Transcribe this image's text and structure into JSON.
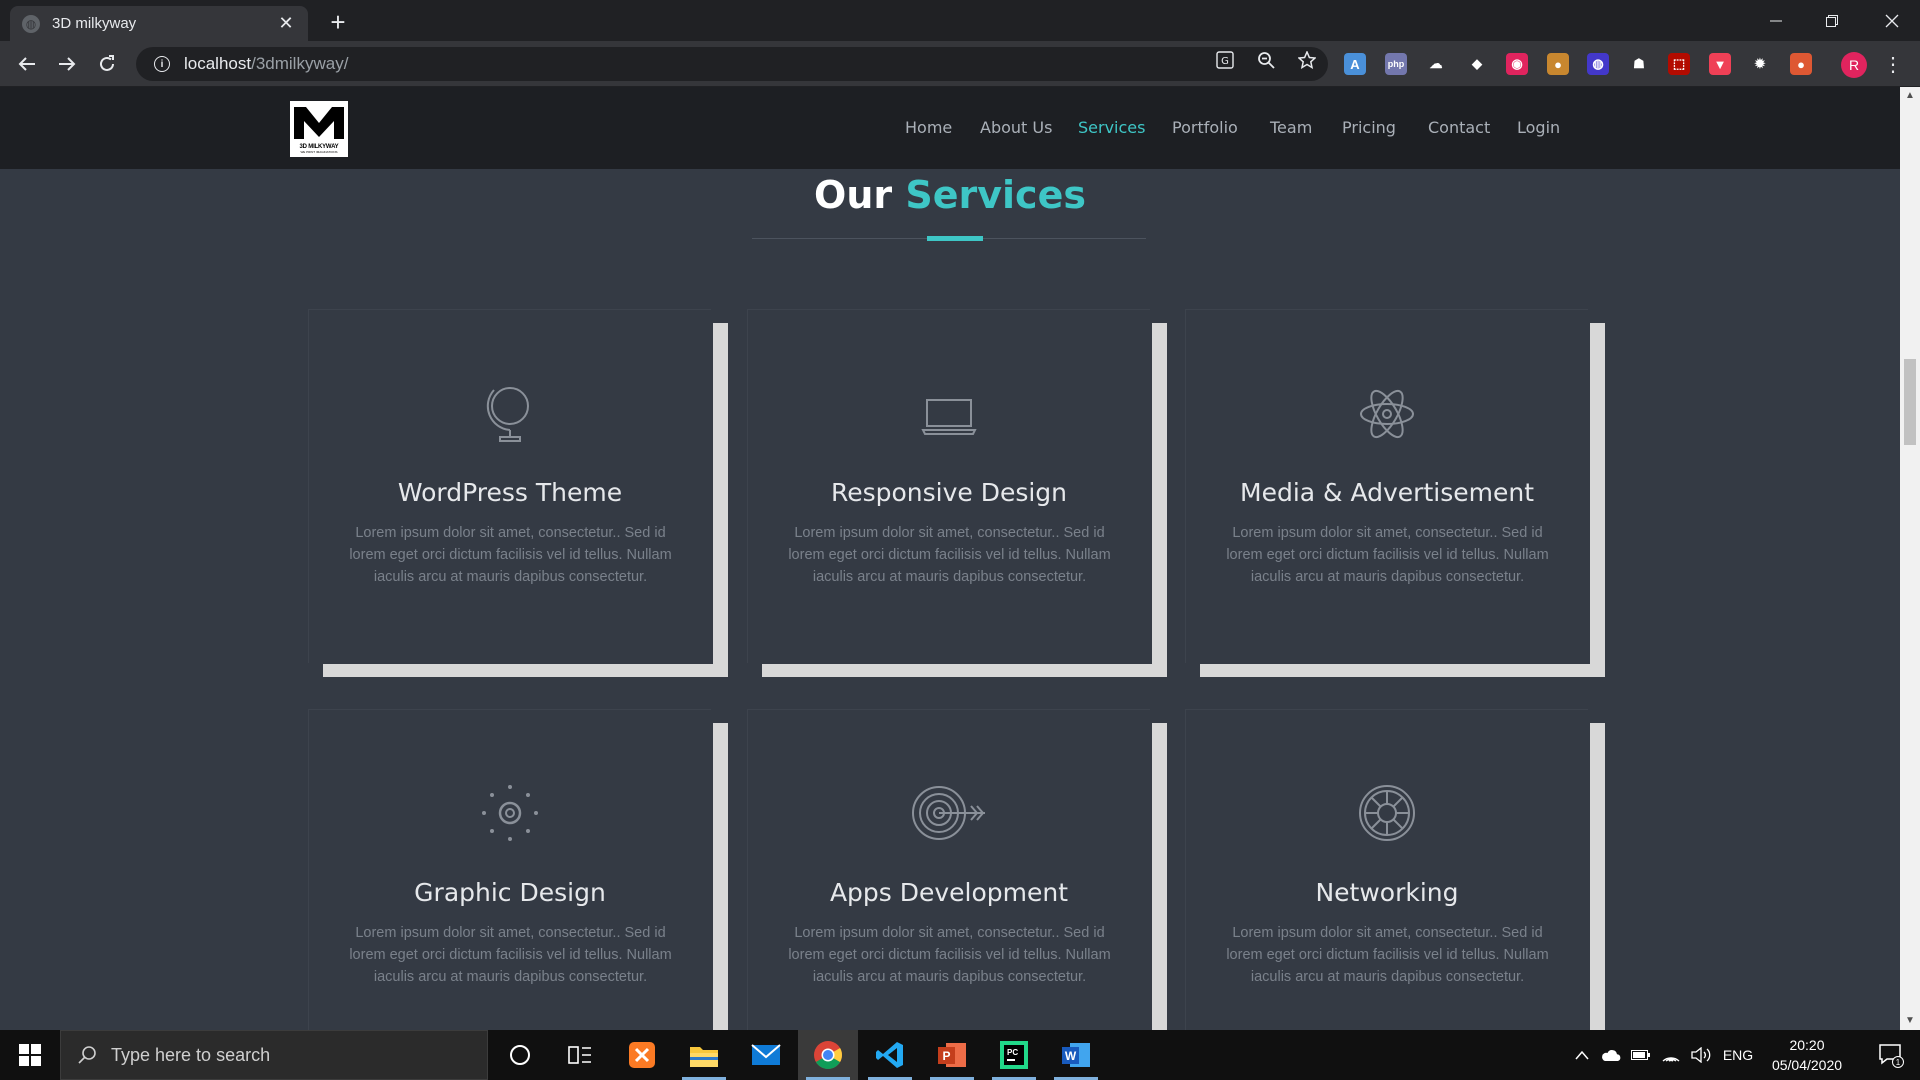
{
  "browser": {
    "tab_title": "3D milkyway",
    "tab_close": "✕",
    "new_tab": "+",
    "url_host": "localhost",
    "url_path": "/3dmilkyway/",
    "profile_initial": "R",
    "extensions": [
      {
        "name": "translate-extension-icon",
        "color": "#4a90d9",
        "glyph": "A"
      },
      {
        "name": "php-extension-icon",
        "color": "#7377ad",
        "glyph": "php"
      },
      {
        "name": "cloud-extension-icon",
        "color": "#35363a",
        "glyph": "☁"
      },
      {
        "name": "shield-extension-icon",
        "color": "#35363a",
        "glyph": "◆"
      },
      {
        "name": "record-extension-icon",
        "color": "#e0245e",
        "glyph": "◉"
      },
      {
        "name": "cookie-extension-icon",
        "color": "#c8872f",
        "glyph": "●"
      },
      {
        "name": "vpn-extension-icon",
        "color": "#4338ca",
        "glyph": "◍"
      },
      {
        "name": "ghost-extension-icon",
        "color": "#35363a",
        "glyph": "☗"
      },
      {
        "name": "pdf-extension-icon",
        "color": "#b30b00",
        "glyph": "⬚"
      },
      {
        "name": "pocket-extension-icon",
        "color": "#ef4056",
        "glyph": "▼"
      },
      {
        "name": "settings-extension-icon",
        "color": "#35363a",
        "glyph": "✹"
      },
      {
        "name": "duckduckgo-extension-icon",
        "color": "#de5833",
        "glyph": "●"
      }
    ]
  },
  "site": {
    "logo_text": "3D MILKYWAY",
    "logo_sub": "WE PRINT IMAGINATIONS",
    "nav": [
      {
        "label": "Home",
        "active": false
      },
      {
        "label": "About Us",
        "active": false
      },
      {
        "label": "Services",
        "active": true
      },
      {
        "label": "Portfolio",
        "active": false
      },
      {
        "label": "Team",
        "active": false
      },
      {
        "label": "Pricing",
        "active": false
      },
      {
        "label": "Contact",
        "active": false
      },
      {
        "label": "Login",
        "active": false
      }
    ],
    "section_title_main": "Our",
    "section_title_accent": "Services",
    "accent_color": "#3ec6c6",
    "services": [
      {
        "title": "WordPress Theme",
        "icon": "globe-icon",
        "text": "Lorem ipsum dolor sit amet, consectetur.. Sed id lorem eget orci dictum facilisis vel id tellus. Nullam iaculis arcu at mauris dapibus consectetur."
      },
      {
        "title": "Responsive Design",
        "icon": "laptop-icon",
        "text": "Lorem ipsum dolor sit amet, consectetur.. Sed id lorem eget orci dictum facilisis vel id tellus. Nullam iaculis arcu at mauris dapibus consectetur."
      },
      {
        "title": "Media & Advertisement",
        "icon": "atom-icon",
        "text": "Lorem ipsum dolor sit amet, consectetur.. Sed id lorem eget orci dictum facilisis vel id tellus. Nullam iaculis arcu at mauris dapibus consectetur."
      },
      {
        "title": "Graphic Design",
        "icon": "aperture-icon",
        "text": "Lorem ipsum dolor sit amet, consectetur.. Sed id lorem eget orci dictum facilisis vel id tellus. Nullam iaculis arcu at mauris dapibus consectetur."
      },
      {
        "title": "Apps Development",
        "icon": "target-icon",
        "text": "Lorem ipsum dolor sit amet, consectetur.. Sed id lorem eget orci dictum facilisis vel id tellus. Nullam iaculis arcu at mauris dapibus consectetur."
      },
      {
        "title": "Networking",
        "icon": "lifebuoy-icon",
        "text": "Lorem ipsum dolor sit amet, consectetur.. Sed id lorem eget orci dictum facilisis vel id tellus. Nullam iaculis arcu at mauris dapibus consectetur."
      }
    ]
  },
  "taskbar": {
    "search_placeholder": "Type here to search",
    "language": "ENG",
    "time": "20:20",
    "date": "05/04/2020",
    "notification_count": "1",
    "apps": [
      {
        "name": "cortana-icon",
        "running": false
      },
      {
        "name": "task-view-icon",
        "running": false
      },
      {
        "name": "xampp-icon",
        "running": false
      },
      {
        "name": "file-explorer-icon",
        "running": true
      },
      {
        "name": "mail-icon",
        "running": false
      },
      {
        "name": "chrome-icon",
        "running": true
      },
      {
        "name": "vscode-icon",
        "running": true
      },
      {
        "name": "powerpoint-icon",
        "running": true
      },
      {
        "name": "pycharm-icon",
        "running": true
      },
      {
        "name": "word-icon",
        "running": true
      }
    ]
  }
}
